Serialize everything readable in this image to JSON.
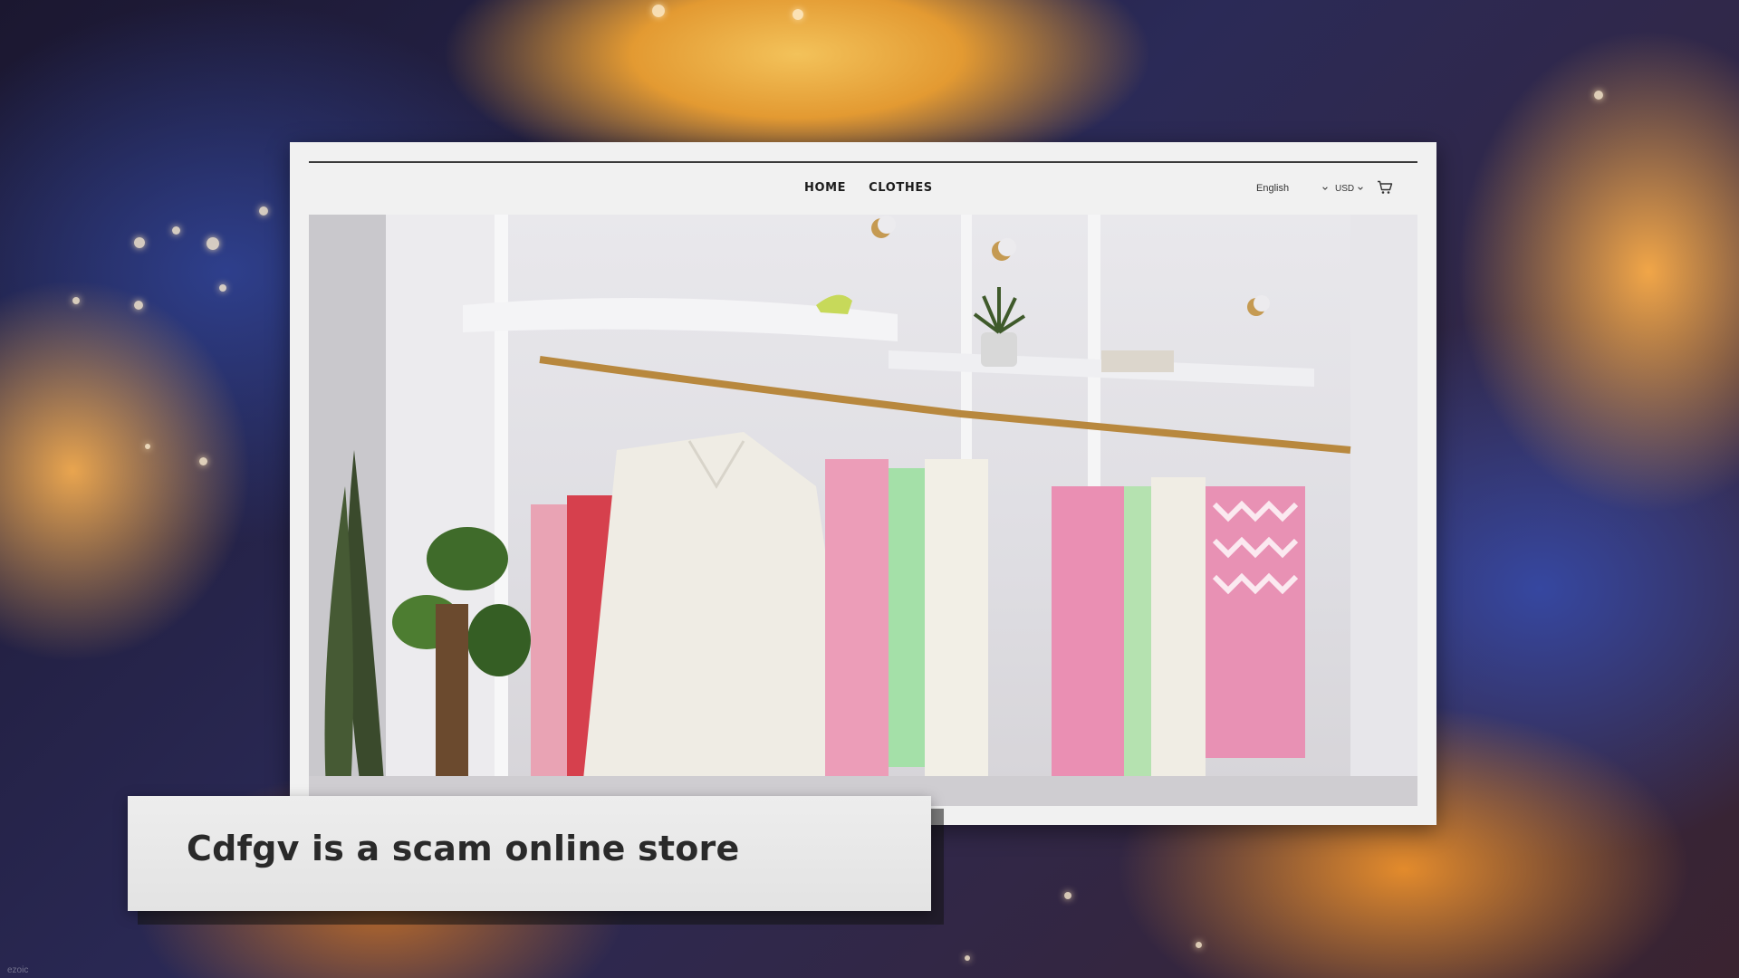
{
  "store": {
    "nav": {
      "items": [
        {
          "label": "HOME"
        },
        {
          "label": "CLOTHES"
        }
      ],
      "language": "English",
      "currency": "USD"
    },
    "hero": {
      "alt": "Clothing boutique interior with garment rails"
    }
  },
  "caption": {
    "text": "Cdfgv is a scam online store"
  },
  "watermark": "ezoic",
  "colors": {
    "caption_bg": "#e8e8e8",
    "caption_text": "#2a2a2a",
    "window_bg": "#f1f1f1"
  }
}
